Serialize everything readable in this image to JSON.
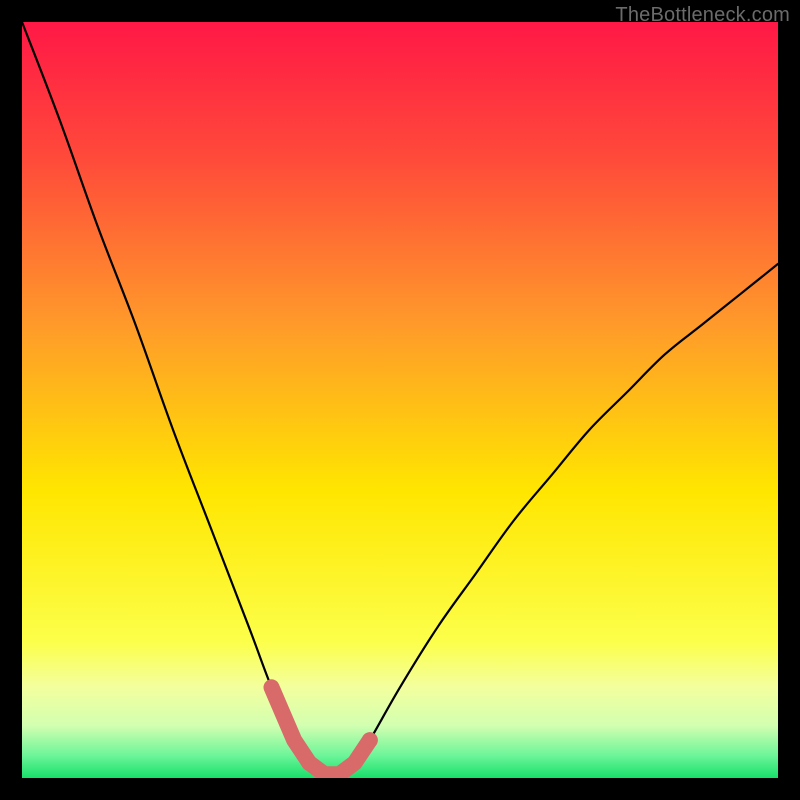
{
  "watermark": "TheBottleneck.com",
  "colors": {
    "gradient_top": "#ff1846",
    "gradient_mid1": "#ff7a2a",
    "gradient_mid2": "#ffe600",
    "gradient_low": "#f6ff9a",
    "gradient_bottom_band": "#e9ffb0",
    "gradient_green": "#18e06a",
    "curve": "#000000",
    "thick": "#d86a6a"
  },
  "chart_data": {
    "type": "line",
    "title": "",
    "xlabel": "",
    "ylabel": "",
    "xlim": [
      0,
      100
    ],
    "ylim": [
      0,
      100
    ],
    "series": [
      {
        "name": "bottleneck-curve",
        "x": [
          0,
          5,
          10,
          15,
          20,
          25,
          30,
          33,
          36,
          38,
          40,
          42,
          44,
          46,
          50,
          55,
          60,
          65,
          70,
          75,
          80,
          85,
          90,
          95,
          100
        ],
        "y": [
          100,
          87,
          73,
          60,
          46,
          33,
          20,
          12,
          5,
          2,
          0.5,
          0.5,
          2,
          5,
          12,
          20,
          27,
          34,
          40,
          46,
          51,
          56,
          60,
          64,
          68
        ]
      }
    ],
    "highlight": {
      "name": "optimal-range",
      "x_range": [
        33,
        46
      ],
      "y_max": 12
    }
  }
}
